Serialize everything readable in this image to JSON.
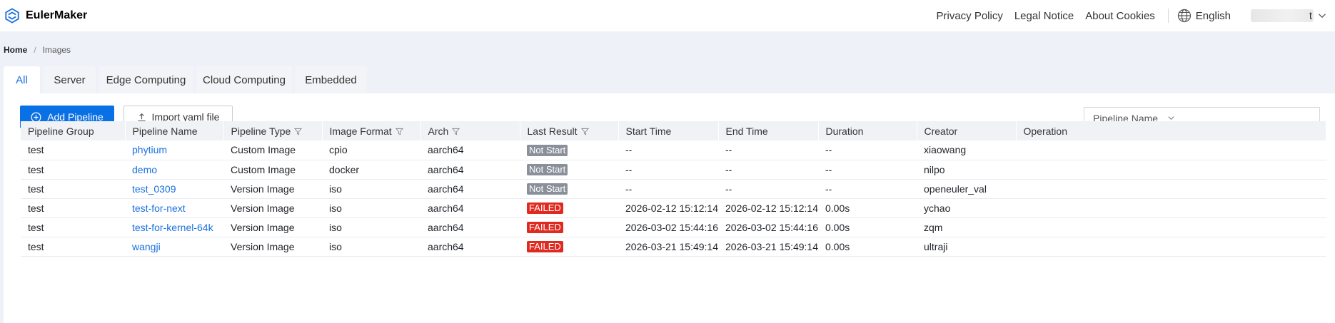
{
  "app": {
    "name": "EulerMaker"
  },
  "topnav": {
    "links": [
      "Privacy Policy",
      "Legal Notice",
      "About Cookies"
    ],
    "language": "English",
    "user_suffix": "t"
  },
  "breadcrumb": {
    "home": "Home",
    "sep": "/",
    "current": "Images"
  },
  "tabs": [
    {
      "label": "All",
      "active": true
    },
    {
      "label": "Server"
    },
    {
      "label": "Edge Computing"
    },
    {
      "label": "Cloud Computing"
    },
    {
      "label": "Embedded"
    }
  ],
  "toolbar": {
    "add_label": "Add Pipeline",
    "import_label": "Import yaml file",
    "search_field": "Pipeline Name",
    "search_value": ""
  },
  "table": {
    "columns": [
      "Pipeline Group",
      "Pipeline Name",
      "Pipeline Type",
      "Image Format",
      "Arch",
      "Last Result",
      "Start Time",
      "End Time",
      "Duration",
      "Creator",
      "Operation"
    ],
    "rows": [
      {
        "group": "test",
        "name": "phytium",
        "type": "Custom Image",
        "format": "cpio",
        "arch": "aarch64",
        "result": "Not Start",
        "start": "--",
        "end": "--",
        "duration": "--",
        "creator": "xiaowang",
        "operation": ""
      },
      {
        "group": "test",
        "name": "demo",
        "type": "Custom Image",
        "format": "docker",
        "arch": "aarch64",
        "result": "Not Start",
        "start": "--",
        "end": "--",
        "duration": "--",
        "creator": "nilpo",
        "operation": ""
      },
      {
        "group": "test",
        "name": "test_0309",
        "type": "Version Image",
        "format": "iso",
        "arch": "aarch64",
        "result": "Not Start",
        "start": "--",
        "end": "--",
        "duration": "--",
        "creator": "openeuler_val",
        "operation": ""
      },
      {
        "group": "test",
        "name": "test-for-next",
        "type": "Version Image",
        "format": "iso",
        "arch": "aarch64",
        "result": "FAILED",
        "start": "2026-02-12 15:12:14",
        "end": "2026-02-12 15:12:14",
        "duration": "0.00s",
        "creator": "ychao",
        "operation": ""
      },
      {
        "group": "test",
        "name": "test-for-kernel-64k",
        "type": "Version Image",
        "format": "iso",
        "arch": "aarch64",
        "result": "FAILED",
        "start": "2026-03-02 15:44:16",
        "end": "2026-03-02 15:44:16",
        "duration": "0.00s",
        "creator": "zqm",
        "operation": ""
      },
      {
        "group": "test",
        "name": "wangji",
        "type": "Version Image",
        "format": "iso",
        "arch": "aarch64",
        "result": "FAILED",
        "start": "2026-03-21 15:49:14",
        "end": "2026-03-21 15:49:14",
        "duration": "0.00s",
        "creator": "ultraji",
        "operation": ""
      }
    ]
  },
  "colors": {
    "primary": "#0a70e6",
    "link": "#1a71e0",
    "failed": "#e0291f",
    "not_start": "#8a9099",
    "page_bg": "#eef2f8"
  }
}
